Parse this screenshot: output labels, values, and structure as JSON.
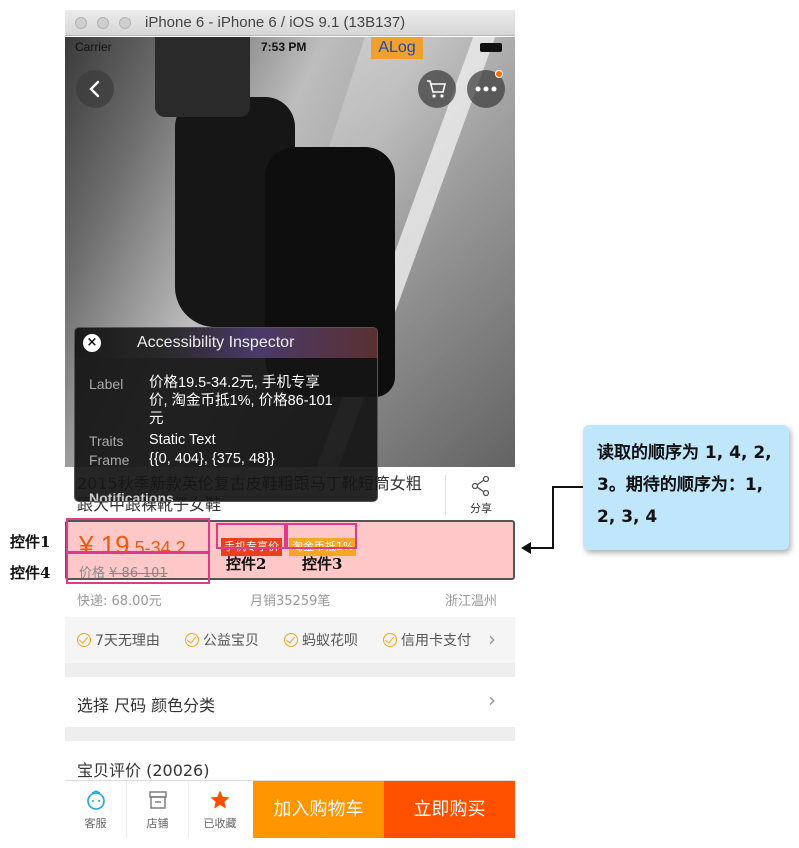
{
  "simulator": {
    "title": "iPhone 6 - iPhone 6 / iOS 9.1 (13B137)"
  },
  "status_bar": {
    "carrier": "Carrier",
    "time": "7:53 PM",
    "alog": "ALog"
  },
  "product": {
    "title": "2015秋季新款英伦复古皮鞋粗跟马丁靴短筒女粗跟大中跟裸靴子女鞋",
    "share_label": "分享",
    "price_symbol": "¥",
    "price_int": "19",
    "price_rest": ".5-34",
    "price_dec": ".2",
    "tag_mobile": "手机专享价",
    "tag_coin": "淘金币抵1%",
    "orig_label": "价格",
    "orig_price": "¥ 86-101",
    "shipping": "快递: 68.00元",
    "monthly_sales": "月销35259笔",
    "location": "浙江温州"
  },
  "services": [
    "7天无理由",
    "公益宝贝",
    "蚂蚁花呗",
    "信用卡支付"
  ],
  "spec": {
    "label": "选择  尺码 颜色分类"
  },
  "review": {
    "label": "宝贝评价 (20026)"
  },
  "bottom_bar": {
    "service": "客服",
    "shop": "店铺",
    "favorite": "已收藏",
    "add_cart": "加入购物车",
    "buy_now": "立即购买"
  },
  "inspector": {
    "title": "Accessibility Inspector",
    "label_key": "Label",
    "label_line1": "价格19.5-34.2元, 手机专享",
    "label_line2": "价, 淘金币抵1%, 价格86-101",
    "label_line3": "元",
    "traits_key": "Traits",
    "traits_val": "Static Text",
    "frame_key": "Frame",
    "frame_val": "{{0, 404}, {375, 48}}",
    "notifications_key": "Notifications"
  },
  "annotations": {
    "ctrl1": "控件1",
    "ctrl2": "控件2",
    "ctrl3": "控件3",
    "ctrl4": "控件4",
    "callout": "读取的顺序为 1, 4, 2, 3。期待的顺序为：1, 2, 3, 4"
  },
  "colors": {
    "price_orange": "#f05a10",
    "band_pink": "#ffc8c8",
    "highlight_magenta": "#e03b8b",
    "cart_orange": "#ff9500",
    "buy_orange": "#ff5000",
    "callout_blue": "#bfe6fb"
  }
}
